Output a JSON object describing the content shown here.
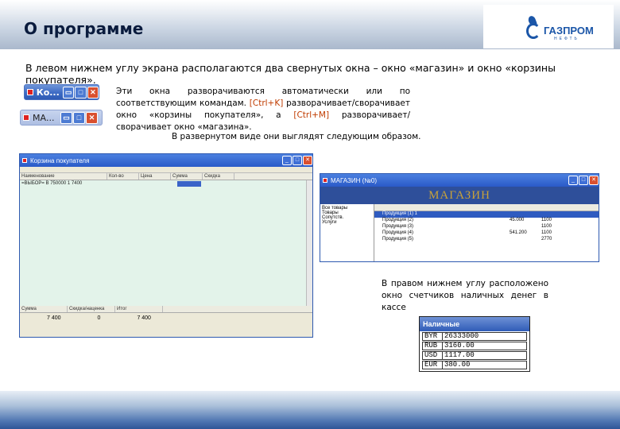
{
  "header": {
    "title": "О программе",
    "logo_text": "ГАЗПРОМ",
    "logo_sub": "НЕФТЬ"
  },
  "intro": "В левом нижнем углу экрана располагаются два свернутых окна – окно «магазин» и окно «корзины покупателя».",
  "minimized": [
    {
      "label": "Ко..."
    },
    {
      "label": "МА..."
    }
  ],
  "description": {
    "part1": "Эти окна разворачиваются автоматически или по соответствующим командам. ",
    "hotkey1": "[Ctrl+K]",
    "part2": " разворачивает/сворачивает окно «корзины покупателя», а ",
    "hotkey2": "[Ctrl+M]",
    "part3": " разворачивает/сворачивает окно «магазина»."
  },
  "expanded_text": "В развернутом виде они выглядят следующим образом.",
  "cart_window": {
    "title": "Корзина покупателя",
    "columns": [
      "Наименование",
      "Кол-во",
      "Цена",
      "Сумма",
      "Скидка"
    ],
    "row": "=ВЫБОР=    В     750000    1    7400",
    "totals_header": [
      "Сумма",
      "Скидка/наценка",
      "Итог"
    ],
    "totals": [
      "7 400",
      "0",
      "7 400"
    ]
  },
  "shop_window": {
    "title": "МАГАЗИН (№0)",
    "banner": "МАГАЗИН",
    "tree_items": [
      "Все товары",
      "Товары",
      "Сопутств.",
      "Услуги"
    ],
    "rows": [
      "Продукция (1) 1",
      "Продукция (2)",
      "Продукция (3)",
      "Продукция (4)",
      "Продукция (5)"
    ],
    "values": [
      "",
      "45.000",
      "",
      "541.200",
      ""
    ],
    "qty": [
      "",
      "1100",
      "1100",
      "1100",
      "2770"
    ]
  },
  "note": "В правом нижнем углу расположено окно счетчиков наличных денег в кассе",
  "cash": {
    "title": "Наличные",
    "rows": [
      {
        "cur": "BYR",
        "val": "26333000"
      },
      {
        "cur": "RUB",
        "val": "3160.00"
      },
      {
        "cur": "USD",
        "val": "1117.00"
      },
      {
        "cur": "EUR",
        "val": "380.00"
      }
    ]
  },
  "colors": {
    "accent": "#1b56a8",
    "hotkey": "#c03c00",
    "title_blue": "#2a5ac8"
  }
}
